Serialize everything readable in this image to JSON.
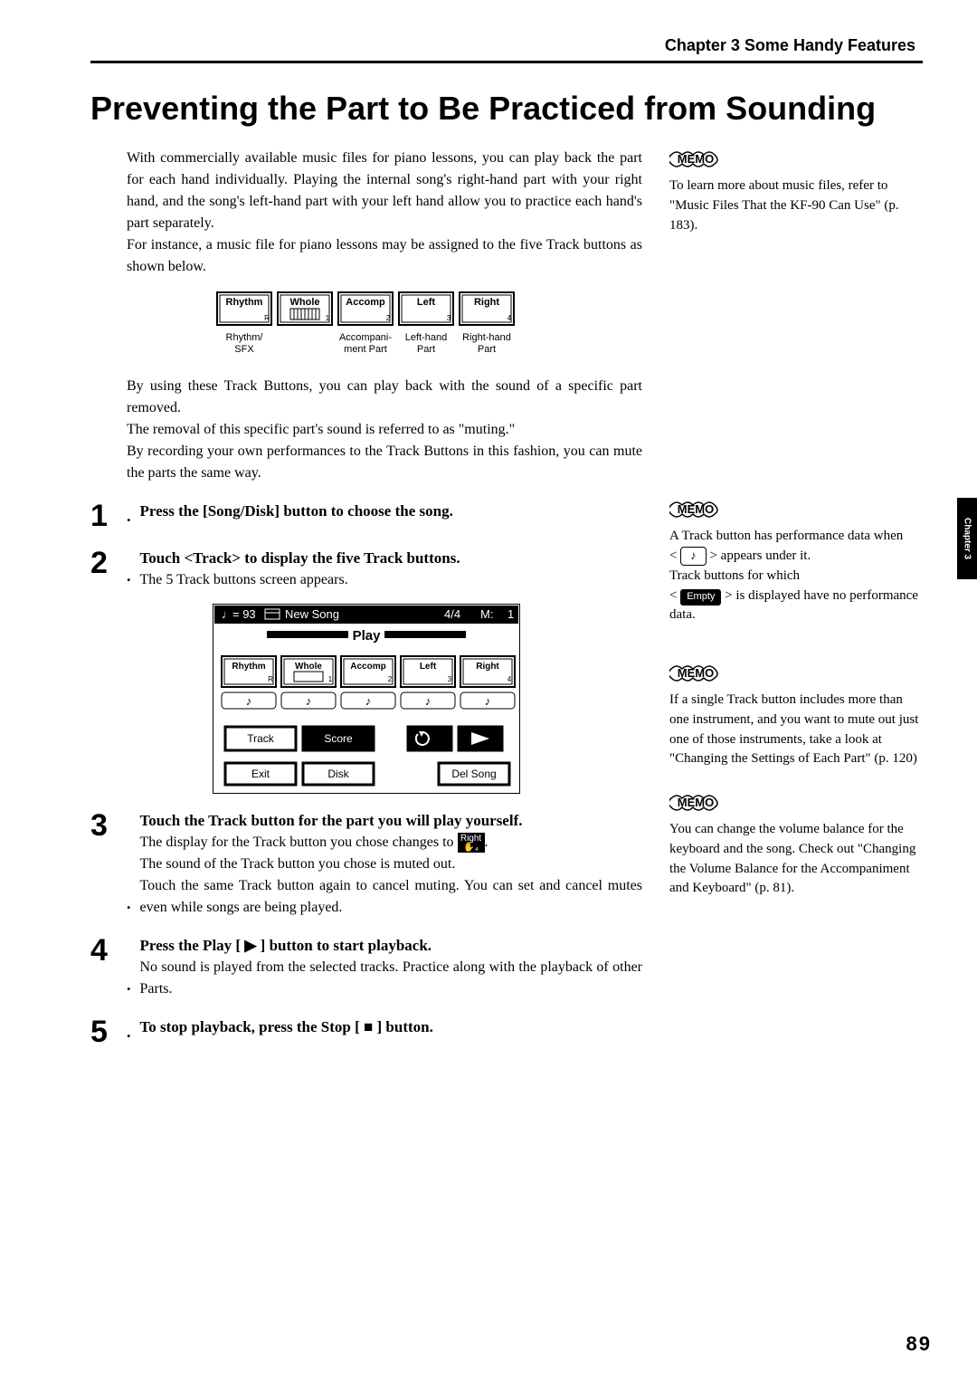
{
  "chapter_header": "Chapter 3 Some Handy Features",
  "title": "Preventing the Part to Be Practiced from Sounding",
  "intro_p1": "With commercially available music files for piano lessons, you can play back the part for each hand individually. Playing the internal song's right-hand part with your right hand, and the song's left-hand part with your left hand allow you to practice each hand's part separately.",
  "intro_p2": "For instance, a music file for piano lessons may be assigned to the five Track buttons as shown below.",
  "track_buttons": [
    "Rhythm",
    "Whole",
    "Accomp",
    "Left",
    "Right"
  ],
  "track_sub_labels": [
    {
      "line1": "Rhythm/",
      "line2": "SFX"
    },
    {
      "line1": "",
      "line2": ""
    },
    {
      "line1": "Accompani-",
      "line2": "ment Part"
    },
    {
      "line1": "Left-hand",
      "line2": "Part"
    },
    {
      "line1": "Right-hand",
      "line2": "Part"
    }
  ],
  "after_fig_p1": "By using these Track Buttons, you can play back with the sound of a specific part removed.",
  "after_fig_p2": "The removal of this specific part's sound is referred to as \"muting.\"",
  "after_fig_p3": "By recording your own performances to the Track Buttons in this fashion, you can mute the parts the same way.",
  "step1": "Press the [Song/Disk] button to choose the song.",
  "step2": "Touch <Track> to display the five Track buttons.",
  "step2_sub": "The 5 Track buttons screen appears.",
  "screen": {
    "header_tempo": "= 93",
    "header_title": "New Song",
    "header_time": "4/4",
    "header_m": "M:",
    "header_meas": "1",
    "banner": "Play",
    "tracks": [
      "Rhythm",
      "Whole",
      "Accomp",
      "Left",
      "Right"
    ],
    "buttons_row": [
      "Track",
      "Score"
    ],
    "bottom_row": [
      "Exit",
      "Disk",
      "Del Song"
    ]
  },
  "step3": "Touch the Track button for the part you will play yourself.",
  "step3_sub1a": "The display for the Track button you chose changes to ",
  "step3_sub1b": ".",
  "right_btn_label": "Right",
  "step3_sub2": "The sound of the Track button you chose is muted out.",
  "step3_sub3": "Touch the same Track button again to cancel muting. You can set and cancel mutes even while songs are being played.",
  "step4": "Press the Play [ ▶ ] button to start playback.",
  "step4_sub": "No sound is played from the selected tracks. Practice along with the playback of other Parts.",
  "step5": "To stop playback, press the Stop [ ■ ] button.",
  "memo1": "To learn more about music files, refer to \"Music Files That the KF-90 Can Use\" (p. 183).",
  "memo2a": "A Track button has performance data when",
  "memo2b_pre": "< ",
  "memo2b_post": " > appears under it.",
  "memo2c": "Track buttons for which",
  "memo2d_pre": "< ",
  "memo2d_label": "Empty",
  "memo2d_post": " > is displayed have no performance data.",
  "memo3": "If a single Track button includes more than one instrument, and you want to mute out just one of those instruments, take a look at \"Changing the Settings of Each Part\" (p. 120)",
  "memo4": "You can change the volume balance for the keyboard and the song. Check out \"Changing the Volume Balance for the Accompaniment and Keyboard\" (p. 81).",
  "side_tab": "Chapter 3",
  "page_num": "89",
  "memo_label": "MEMO"
}
